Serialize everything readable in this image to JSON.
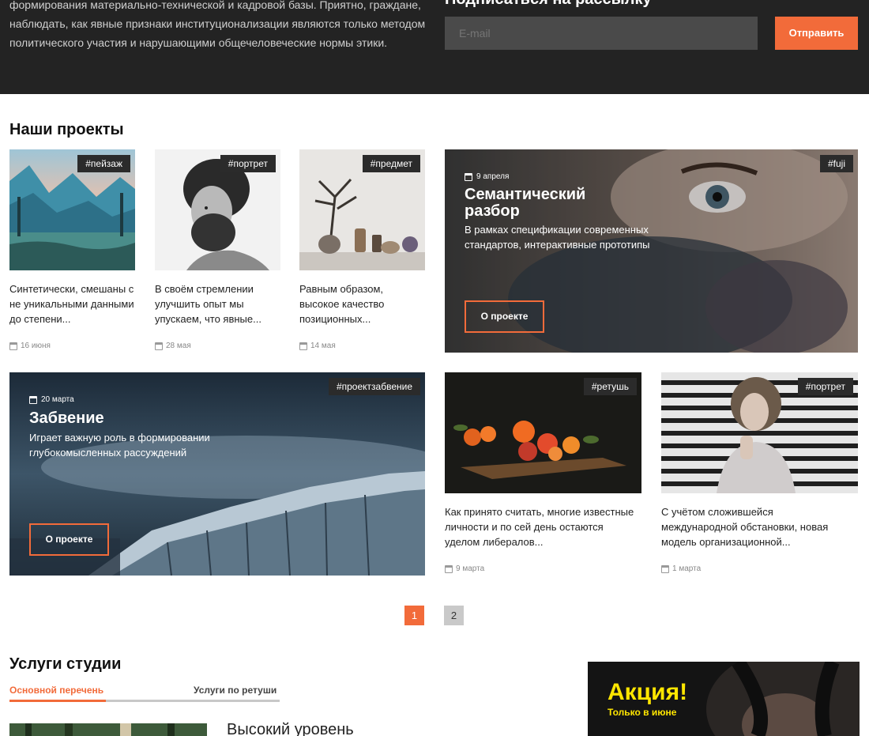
{
  "newsletter": {
    "description": "формирования материально-технической и кадровой базы. Приятно, граждане, наблюдать, как явные признаки институционализации являются только методом политического участия и нарушающими общечеловеческие нормы этики.",
    "title": "Подписаться на рассылку",
    "email_placeholder": "E-mail",
    "send_label": "Отправить"
  },
  "projects": {
    "title": "Наши проекты",
    "cards": [
      {
        "tag": "#пейзаж",
        "text": "Синтетически, смешаны с не уникальными данными до степени...",
        "date": "16 июня",
        "icon": "landscape-photo"
      },
      {
        "tag": "#портрет",
        "text": "В своём стремлении улучшить опыт мы упускаем, что явные...",
        "date": "28 мая",
        "icon": "portrait-photo"
      },
      {
        "tag": "#предмет",
        "text": "Равным образом, высокое качество позиционных...",
        "date": "14 мая",
        "icon": "still-life-photo"
      },
      {
        "tag": "#ретушь",
        "text": "Как принято считать, многие известные личности и по сей день остаются уделом либералов...",
        "date": "9 марта",
        "icon": "oranges-photo"
      },
      {
        "tag": "#портрет",
        "text": "С учётом сложившейся международной обстановки, новая модель организационной...",
        "date": "1 марта",
        "icon": "woman-portrait-photo"
      }
    ],
    "features": [
      {
        "tag": "#fuji",
        "date": "9 апреля",
        "title": "Семантический разбор",
        "text": "В рамках спецификации современных стандартов, интерактивные прототипы",
        "button": "О проекте"
      },
      {
        "tag": "#проектзабвение",
        "date": "20 марта",
        "title": "Забвение",
        "text": "Играет важную роль в формировании глубокомысленных рассуждений",
        "button": "О проекте"
      }
    ]
  },
  "pagination": {
    "pages": [
      "1",
      "2"
    ],
    "active": "1"
  },
  "services": {
    "title": "Услуги студии",
    "tabs": [
      "Основной перечень",
      "Услуги по ретуши"
    ],
    "item_heading": "Высокий уровень"
  },
  "promo": {
    "title": "Акция!",
    "subtitle": "Только в июне"
  },
  "colors": {
    "accent": "#f26b3a",
    "dark": "#232323",
    "promo_yellow": "#ffe600"
  }
}
